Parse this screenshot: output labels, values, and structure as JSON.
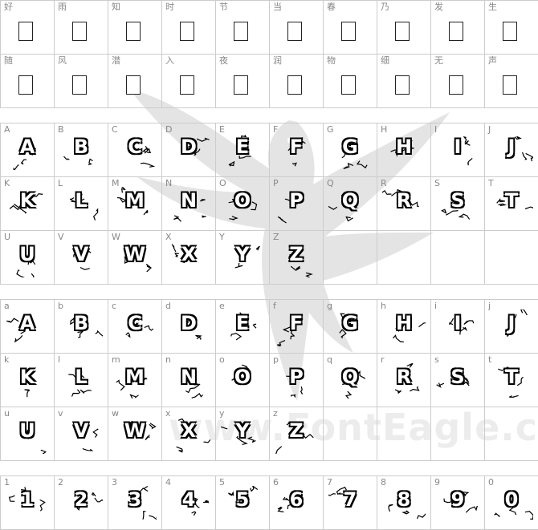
{
  "watermark": "www.FontEagle.com",
  "cjk_rows": [
    [
      "好",
      "雨",
      "知",
      "时",
      "节",
      "当",
      "春",
      "乃",
      "发",
      "生"
    ],
    [
      "随",
      "风",
      "潜",
      "入",
      "夜",
      "润",
      "物",
      "细",
      "无",
      "声"
    ]
  ],
  "upper_rows": [
    [
      "A",
      "B",
      "C",
      "D",
      "E",
      "F",
      "G",
      "H",
      "I",
      "J"
    ],
    [
      "K",
      "L",
      "M",
      "N",
      "O",
      "P",
      "Q",
      "R",
      "S",
      "T"
    ],
    [
      "U",
      "V",
      "W",
      "X",
      "Y",
      "Z"
    ]
  ],
  "lower_rows": [
    {
      "labels": [
        "a",
        "b",
        "c",
        "d",
        "e",
        "f",
        "g",
        "h",
        "i",
        "j"
      ],
      "glyphs": [
        "A",
        "B",
        "C",
        "D",
        "E",
        "F",
        "G",
        "H",
        "I",
        "J"
      ]
    },
    {
      "labels": [
        "k",
        "l",
        "m",
        "n",
        "o",
        "p",
        "q",
        "r",
        "s",
        "t"
      ],
      "glyphs": [
        "K",
        "L",
        "M",
        "N",
        "O",
        "P",
        "Q",
        "R",
        "S",
        "T"
      ]
    },
    {
      "labels": [
        "u",
        "v",
        "w",
        "x",
        "y",
        "z"
      ],
      "glyphs": [
        "U",
        "V",
        "W",
        "X",
        "Y",
        "Z"
      ]
    }
  ],
  "digits": [
    "1",
    "2",
    "3",
    "4",
    "5",
    "6",
    "7",
    "8",
    "9",
    "0"
  ]
}
